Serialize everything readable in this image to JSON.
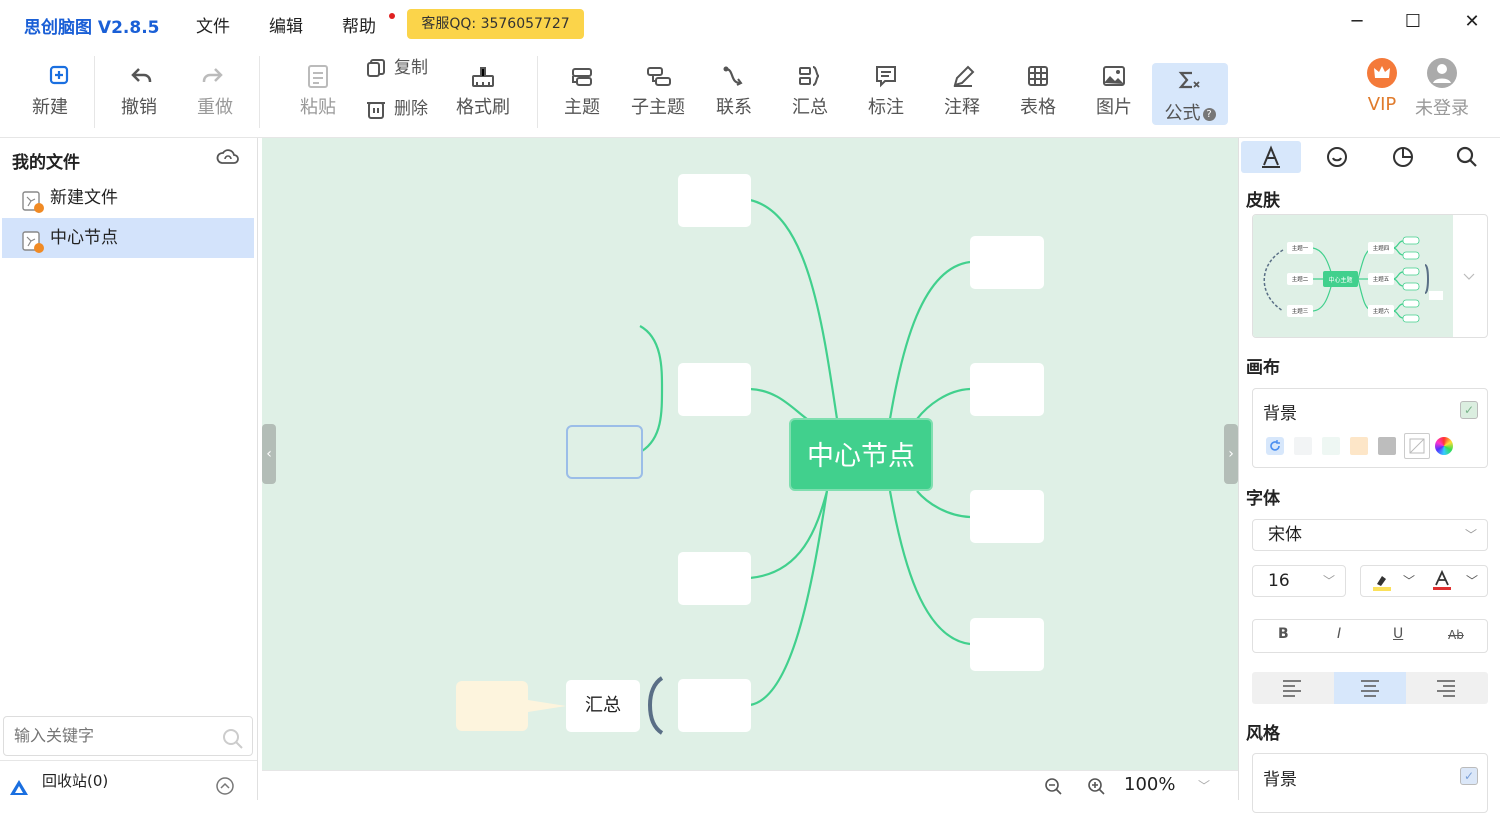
{
  "app": {
    "title": "思创脑图 V2.8.5"
  },
  "menu": {
    "file": "文件",
    "edit": "编辑",
    "help": "帮助",
    "support": "客服QQ: 3576057727"
  },
  "toolbar": {
    "new": "新建",
    "undo": "撤销",
    "redo": "重做",
    "paste": "粘贴",
    "copy": "复制",
    "delete": "删除",
    "format_brush": "格式刷",
    "topic": "主题",
    "subtopic": "子主题",
    "relation": "联系",
    "summary": "汇总",
    "label": "标注",
    "comment": "注释",
    "table": "表格",
    "image": "图片",
    "formula": "公式",
    "vip": "VIP",
    "login": "未登录"
  },
  "sidebar": {
    "header": "我的文件",
    "files": [
      "新建文件",
      "中心节点"
    ],
    "selected_index": 1,
    "search_placeholder": "输入关键字",
    "recycle": "回收站(0)"
  },
  "canvas": {
    "center_node": "中心节点",
    "summary_node": "汇总",
    "background": "#dff0e6",
    "accent": "#41d08d"
  },
  "status": {
    "zoom": "100%"
  },
  "rpanel": {
    "skin_title": "皮肤",
    "canvas_title": "画布",
    "background_label": "背景",
    "font_title": "字体",
    "font_family": "宋体",
    "font_size": "16",
    "style_title": "风格",
    "style_background": "背景",
    "skin_preview": {
      "center": "中心主题",
      "left": [
        "主题一",
        "主题二",
        "主题三"
      ],
      "right": [
        "主题四",
        "主题五",
        "主题六"
      ]
    }
  }
}
